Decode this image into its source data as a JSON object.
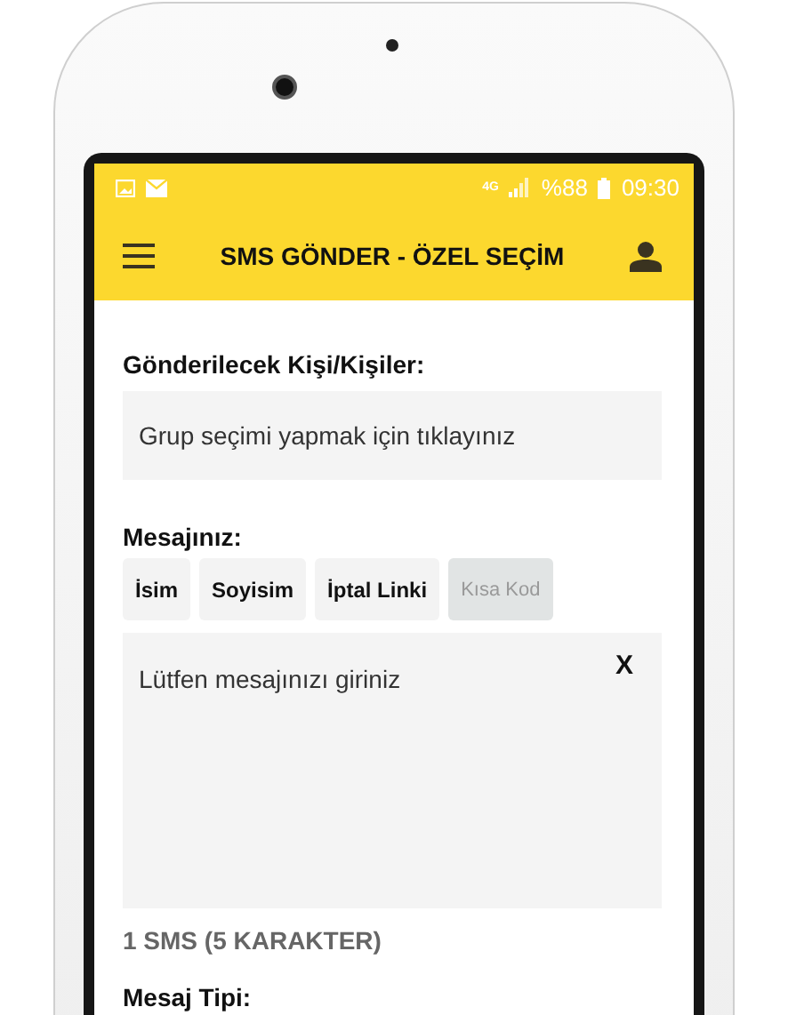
{
  "status_bar": {
    "network": "4G",
    "battery": "%88",
    "time": "09:30"
  },
  "app_bar": {
    "title": "SMS GÖNDER - ÖZEL SEÇİM"
  },
  "recipients": {
    "label": "Gönderilecek Kişi/Kişiler:",
    "placeholder": "Grup seçimi yapmak için tıklayınız"
  },
  "message": {
    "label": "Mesajınız:",
    "chips": [
      {
        "label": "İsim",
        "disabled": false
      },
      {
        "label": "Soyisim",
        "disabled": false
      },
      {
        "label": "İptal Linki",
        "disabled": false
      },
      {
        "label": "Kısa Kod",
        "disabled": true
      }
    ],
    "placeholder": "Lütfen mesajınızı giriniz",
    "clear": "X",
    "counter": "1 SMS (5 KARAKTER)"
  },
  "message_type": {
    "label": "Mesaj Tipi:"
  }
}
